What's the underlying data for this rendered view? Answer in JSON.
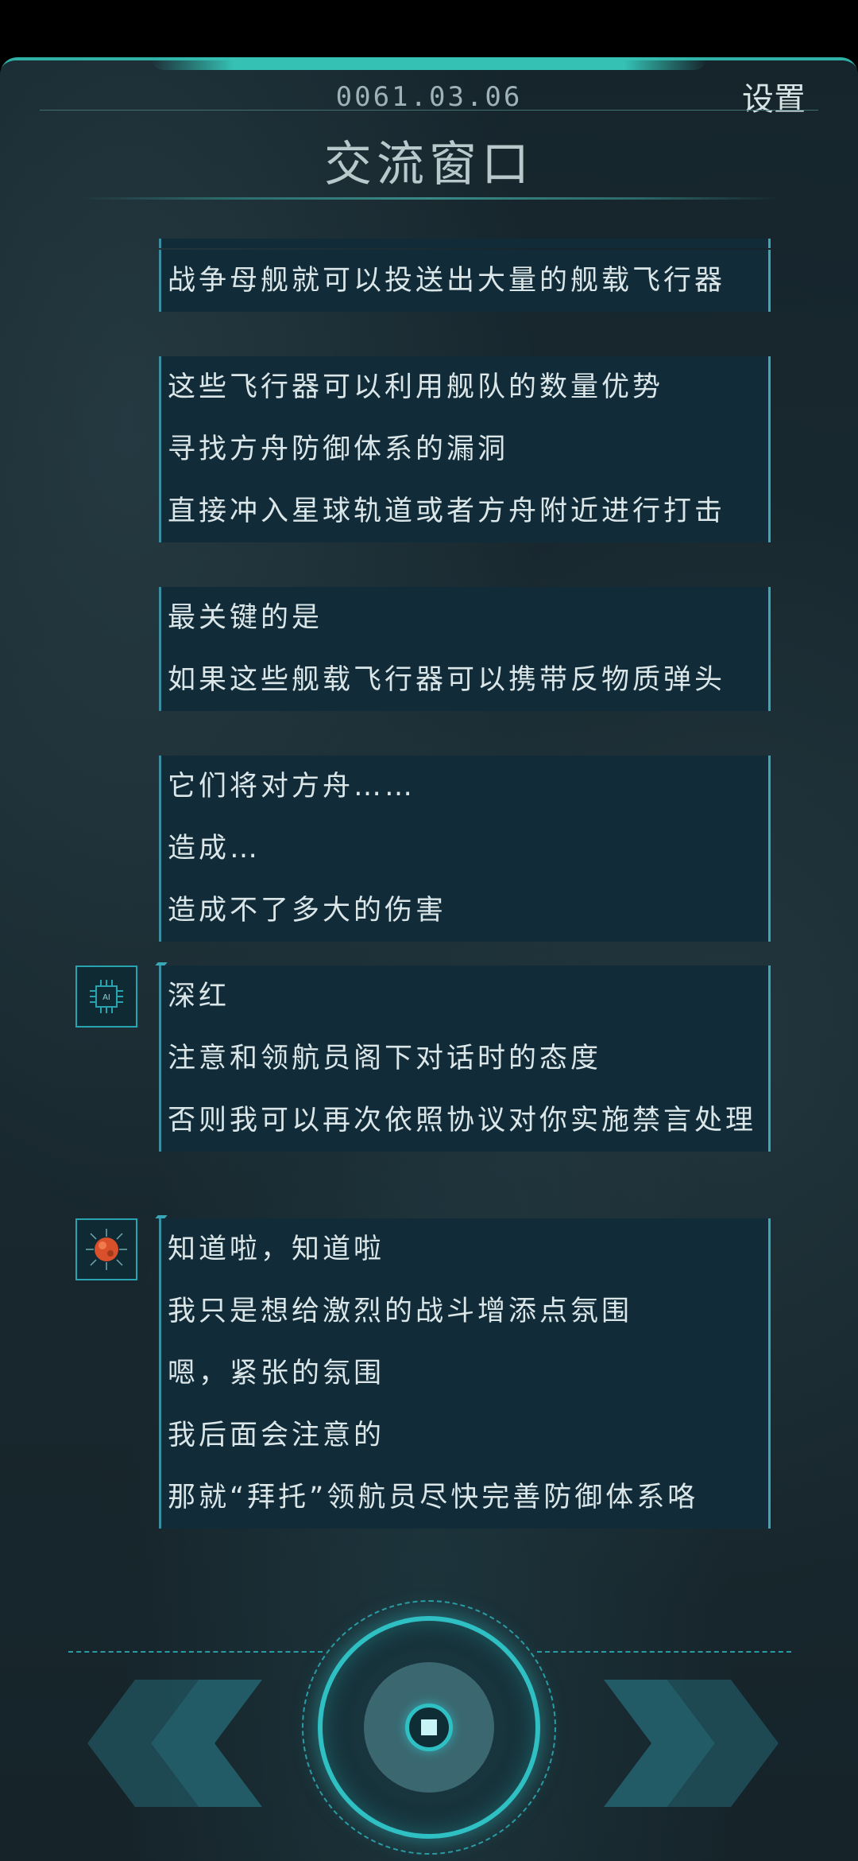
{
  "header": {
    "date": "0061.03.06",
    "settings_label": "设置",
    "title": "交流窗口"
  },
  "messages": [
    {
      "text": "战争母舰就可以投送出大量的舰载飞行器"
    },
    {
      "text": "这些飞行器可以利用舰队的数量优势"
    },
    {
      "text": "寻找方舟防御体系的漏洞"
    },
    {
      "text": "直接冲入星球轨道或者方舟附近进行打击"
    },
    {
      "text": "最关键的是"
    },
    {
      "text": "如果这些舰载飞行器可以携带反物质弹头"
    },
    {
      "text": "它们将对方舟……"
    },
    {
      "text": "造成…"
    },
    {
      "text": "造成不了多大的伤害"
    },
    {
      "text": "深红"
    },
    {
      "text": "注意和领航员阁下对话时的态度"
    },
    {
      "text": "否则我可以再次依照协议对你实施禁言处理"
    },
    {
      "text": "知道啦，知道啦"
    },
    {
      "text": "我只是想给激烈的战斗增添点氛围"
    },
    {
      "text": "嗯，紧张的氛围"
    },
    {
      "text": "我后面会注意的"
    },
    {
      "text": "那就“拜托”领航员尽快完善防御体系咯"
    }
  ],
  "avatars": {
    "ai_label": "AI",
    "ai_icon": "ai-chip-icon",
    "user_icon": "red-planet-avatar-icon"
  },
  "controls": {
    "prev_icon": "double-chevron-left-icon",
    "next_icon": "double-chevron-right-icon",
    "main_icon": "circle-button-icon"
  },
  "colors": {
    "accent": "#2fc0c4",
    "bubble": "#112c38",
    "text": "#dbe6e8"
  }
}
